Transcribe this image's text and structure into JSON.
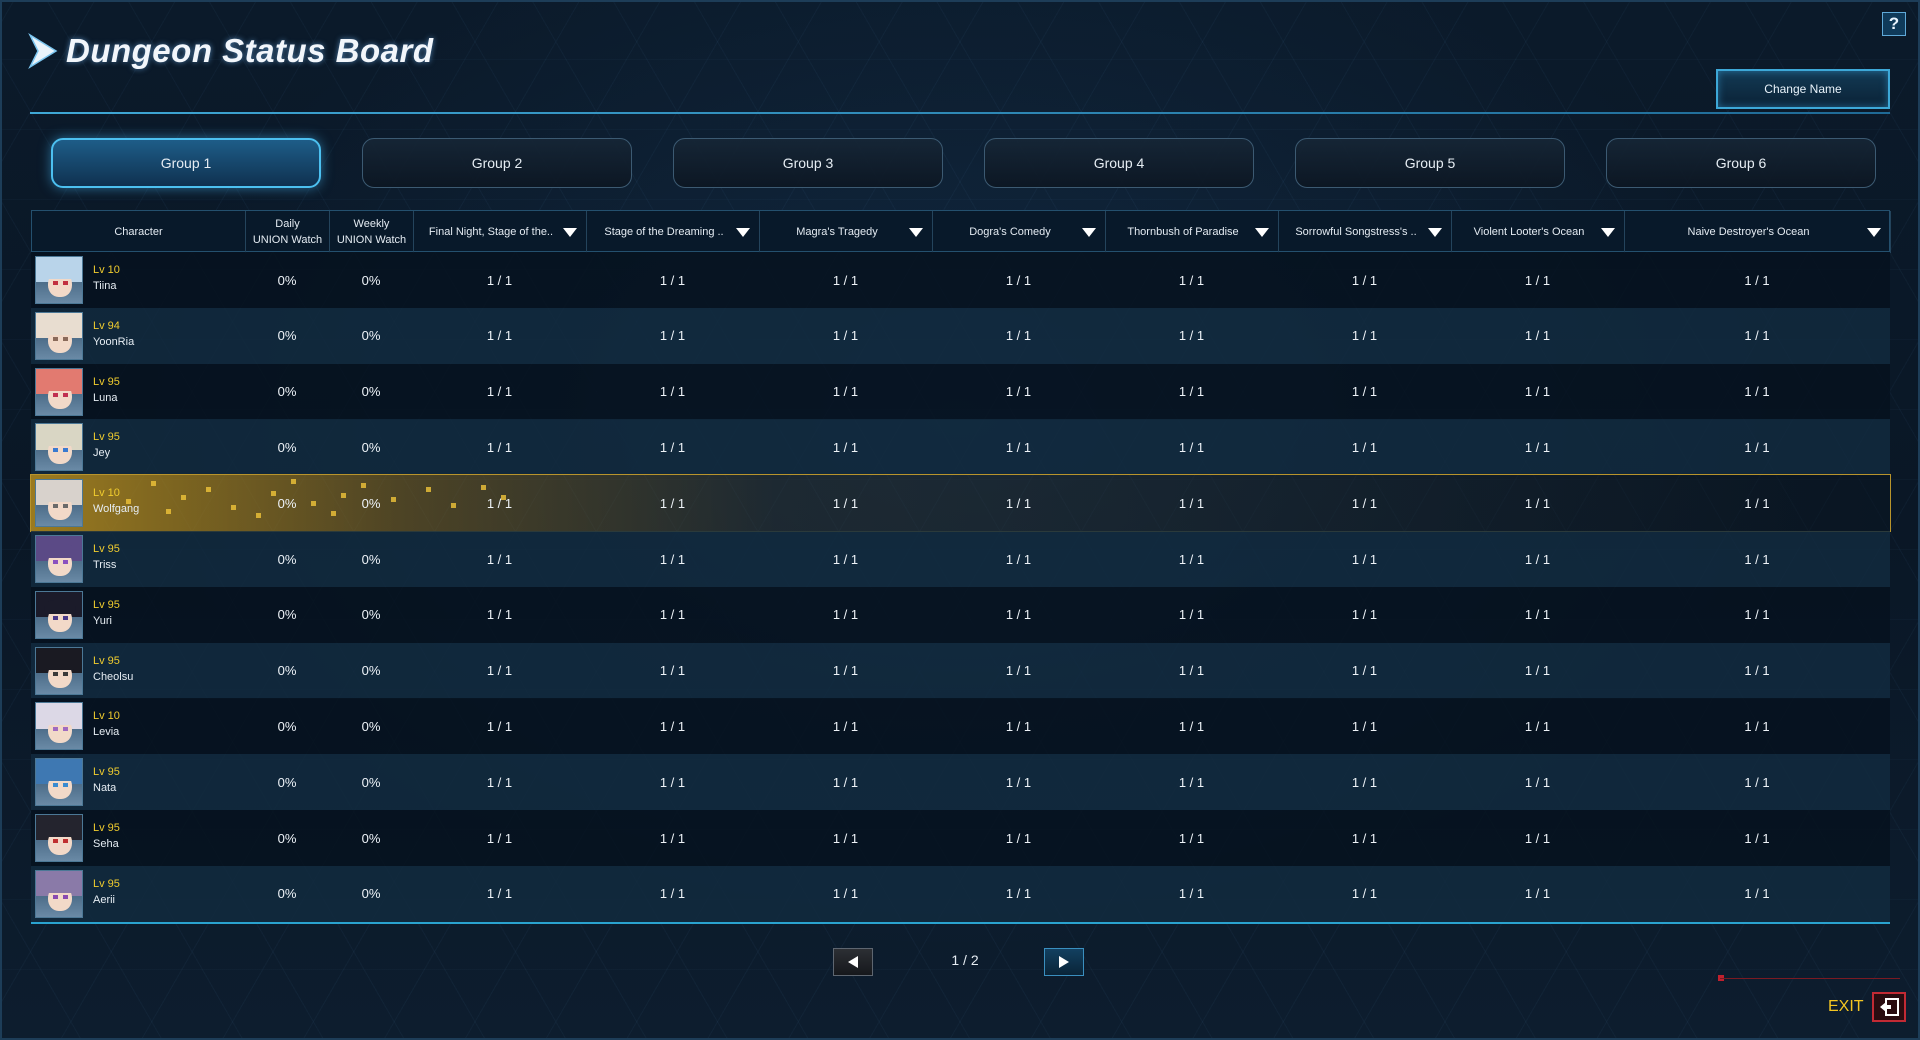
{
  "header": {
    "title": "Dungeon Status Board",
    "change_name_label": "Change Name",
    "help_label": "?"
  },
  "tabs": [
    {
      "label": "Group 1",
      "active": true
    },
    {
      "label": "Group 2",
      "active": false
    },
    {
      "label": "Group 3",
      "active": false
    },
    {
      "label": "Group 4",
      "active": false
    },
    {
      "label": "Group 5",
      "active": false
    },
    {
      "label": "Group 6",
      "active": false
    }
  ],
  "table": {
    "columns": [
      {
        "label": "Character"
      },
      {
        "label": "Daily\nUNION Watch"
      },
      {
        "label": "Weekly\nUNION Watch"
      },
      {
        "label": "Final Night, Stage of the..",
        "dropdown": true
      },
      {
        "label": "Stage of the Dreaming ..",
        "dropdown": true
      },
      {
        "label": "Magra's Tragedy",
        "dropdown": true
      },
      {
        "label": "Dogra's Comedy",
        "dropdown": true
      },
      {
        "label": "Thornbush of Paradise",
        "dropdown": true
      },
      {
        "label": "Sorrowful Songstress's ..",
        "dropdown": true
      },
      {
        "label": "Violent Looter's Ocean",
        "dropdown": true
      },
      {
        "label": "Naive Destroyer's Ocean",
        "dropdown": true
      }
    ],
    "rows": [
      {
        "level": "Lv 10",
        "name": "Tiina",
        "daily": "0%",
        "weekly": "0%",
        "dungeons": [
          "1 / 1",
          "1 / 1",
          "1 / 1",
          "1 / 1",
          "1 / 1",
          "1 / 1",
          "1 / 1",
          "1 / 1"
        ]
      },
      {
        "level": "Lv 94",
        "name": "YoonRia",
        "daily": "0%",
        "weekly": "0%",
        "dungeons": [
          "1 / 1",
          "1 / 1",
          "1 / 1",
          "1 / 1",
          "1 / 1",
          "1 / 1",
          "1 / 1",
          "1 / 1"
        ]
      },
      {
        "level": "Lv 95",
        "name": "Luna",
        "daily": "0%",
        "weekly": "0%",
        "dungeons": [
          "1 / 1",
          "1 / 1",
          "1 / 1",
          "1 / 1",
          "1 / 1",
          "1 / 1",
          "1 / 1",
          "1 / 1"
        ]
      },
      {
        "level": "Lv 95",
        "name": "Jey",
        "daily": "0%",
        "weekly": "0%",
        "dungeons": [
          "1 / 1",
          "1 / 1",
          "1 / 1",
          "1 / 1",
          "1 / 1",
          "1 / 1",
          "1 / 1",
          "1 / 1"
        ]
      },
      {
        "level": "Lv 10",
        "name": "Wolfgang",
        "daily": "0%",
        "weekly": "0%",
        "highlighted": true,
        "dungeons": [
          "1 / 1",
          "1 / 1",
          "1 / 1",
          "1 / 1",
          "1 / 1",
          "1 / 1",
          "1 / 1",
          "1 / 1"
        ]
      },
      {
        "level": "Lv 95",
        "name": "Triss",
        "daily": "0%",
        "weekly": "0%",
        "dungeons": [
          "1 / 1",
          "1 / 1",
          "1 / 1",
          "1 / 1",
          "1 / 1",
          "1 / 1",
          "1 / 1",
          "1 / 1"
        ]
      },
      {
        "level": "Lv 95",
        "name": "Yuri",
        "daily": "0%",
        "weekly": "0%",
        "dungeons": [
          "1 / 1",
          "1 / 1",
          "1 / 1",
          "1 / 1",
          "1 / 1",
          "1 / 1",
          "1 / 1",
          "1 / 1"
        ]
      },
      {
        "level": "Lv 95",
        "name": "Cheolsu",
        "daily": "0%",
        "weekly": "0%",
        "dungeons": [
          "1 / 1",
          "1 / 1",
          "1 / 1",
          "1 / 1",
          "1 / 1",
          "1 / 1",
          "1 / 1",
          "1 / 1"
        ]
      },
      {
        "level": "Lv 10",
        "name": "Levia",
        "daily": "0%",
        "weekly": "0%",
        "dungeons": [
          "1 / 1",
          "1 / 1",
          "1 / 1",
          "1 / 1",
          "1 / 1",
          "1 / 1",
          "1 / 1",
          "1 / 1"
        ]
      },
      {
        "level": "Lv 95",
        "name": "Nata",
        "daily": "0%",
        "weekly": "0%",
        "dungeons": [
          "1 / 1",
          "1 / 1",
          "1 / 1",
          "1 / 1",
          "1 / 1",
          "1 / 1",
          "1 / 1",
          "1 / 1"
        ]
      },
      {
        "level": "Lv 95",
        "name": "Seha",
        "daily": "0%",
        "weekly": "0%",
        "dungeons": [
          "1 / 1",
          "1 / 1",
          "1 / 1",
          "1 / 1",
          "1 / 1",
          "1 / 1",
          "1 / 1",
          "1 / 1"
        ]
      },
      {
        "level": "Lv 95",
        "name": "Aerii",
        "daily": "0%",
        "weekly": "0%",
        "dungeons": [
          "1 / 1",
          "1 / 1",
          "1 / 1",
          "1 / 1",
          "1 / 1",
          "1 / 1",
          "1 / 1",
          "1 / 1"
        ]
      }
    ]
  },
  "pagination": {
    "label": "1 / 2",
    "current": 1,
    "total": 2
  },
  "exit": {
    "label": "EXIT"
  },
  "colors": {
    "accent": "#3da8d8",
    "level": "#f0cc2e",
    "exit": "#c22a34",
    "highlight": "#b8942c"
  },
  "icons": {
    "title": "chevron-right-icon",
    "dropdown": "triangle-down-icon",
    "prev": "triangle-left-icon",
    "next": "triangle-right-icon",
    "exit": "exit-door-icon",
    "help": "question-icon"
  }
}
